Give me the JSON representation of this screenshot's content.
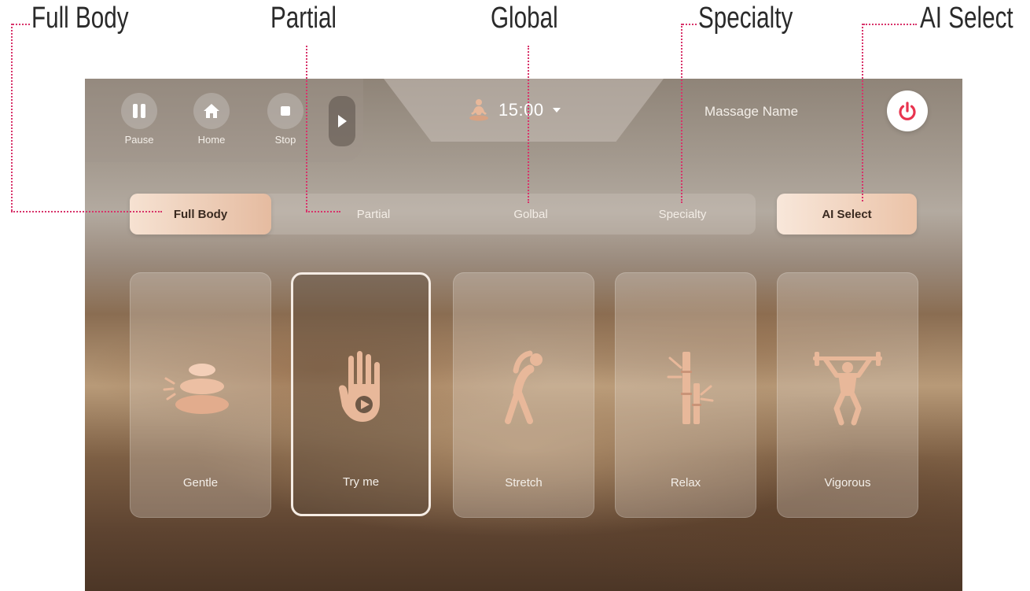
{
  "callouts": {
    "full_body": "Full Body",
    "partial": "Partial",
    "global": "Global",
    "specialty": "Specialty",
    "ai_select": "AI Select"
  },
  "controls": {
    "pause_label": "Pause",
    "home_label": "Home",
    "stop_label": "Stop"
  },
  "timer": {
    "value": "15:00"
  },
  "massage_name": "Massage Name",
  "tabs": {
    "items": [
      {
        "label": "Full Body",
        "active": true
      },
      {
        "label": "Partial",
        "active": false
      },
      {
        "label": "Golbal",
        "active": false
      },
      {
        "label": "Specialty",
        "active": false
      }
    ],
    "ai_select_label": "AI Select"
  },
  "modes": [
    {
      "label": "Gentle",
      "icon": "stacked-stones-icon",
      "selected": false
    },
    {
      "label": "Try me",
      "icon": "hand-play-icon",
      "selected": true
    },
    {
      "label": "Stretch",
      "icon": "stretching-person-icon",
      "selected": false
    },
    {
      "label": "Relax",
      "icon": "bamboo-icon",
      "selected": false
    },
    {
      "label": "Vigorous",
      "icon": "weightlifter-icon",
      "selected": false
    }
  ],
  "colors": {
    "accent": "#e5bba0",
    "accent_light": "#f6e2d2",
    "icon": "#e8b89a",
    "power_icon": "#e8344f",
    "callout_line": "#d8336a"
  }
}
